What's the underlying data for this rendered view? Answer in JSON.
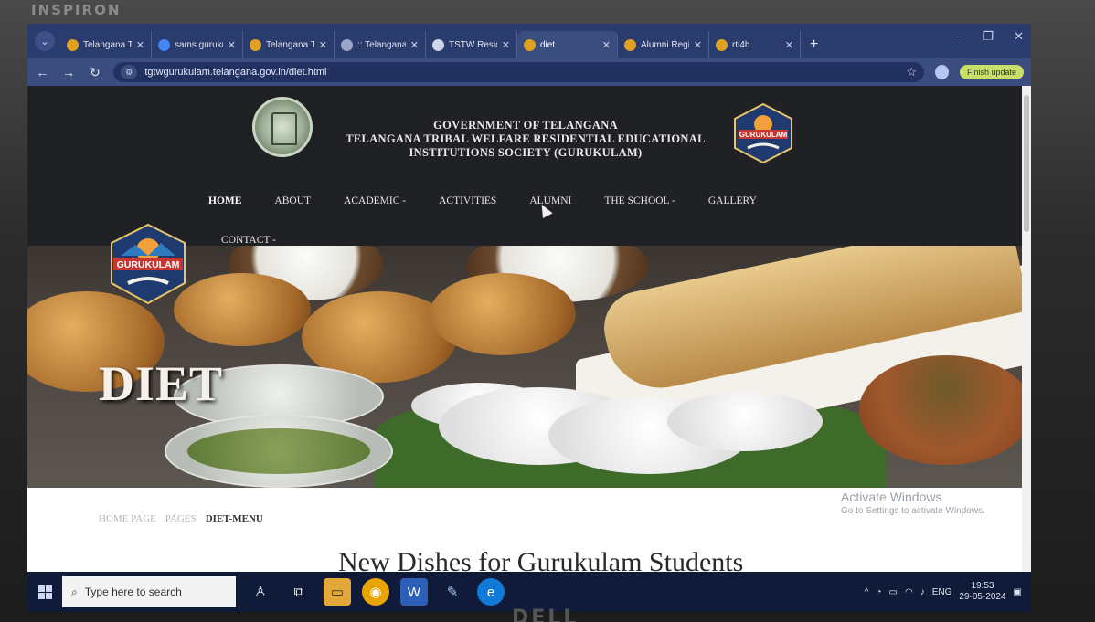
{
  "monitor": {
    "brand_top": "INSPIRON",
    "brand_bottom": "DELL"
  },
  "browser": {
    "tabs": [
      {
        "title": "Telangana Tr",
        "favicon_color": "#e0a020",
        "active": false
      },
      {
        "title": "sams gurukul",
        "favicon_color": "#4285f4",
        "active": false
      },
      {
        "title": "Telangana Tr",
        "favicon_color": "#e0a020",
        "active": false
      },
      {
        "title": ":: Telangana",
        "favicon_color": "#9aa7c9",
        "active": false
      },
      {
        "title": "TSTW Reside",
        "favicon_color": "#cfd6ea",
        "active": false
      },
      {
        "title": "diet",
        "favicon_color": "#e0a020",
        "active": true
      },
      {
        "title": "Alumni Regi",
        "favicon_color": "#e0a020",
        "active": false
      },
      {
        "title": "rti4b",
        "favicon_color": "#e0a020",
        "active": false
      }
    ],
    "url": "tgtwgurukulam.telangana.gov.in/diet.html",
    "update_label": "Finish update"
  },
  "page": {
    "gov_title_line1": "GOVERNMENT OF TELANGANA",
    "gov_title_line2": "TELANGANA TRIBAL WELFARE RESIDENTIAL EDUCATIONAL",
    "gov_title_line3": "INSTITUTIONS SOCIETY (GURUKULAM)",
    "logo_text": "GURUKULAM",
    "nav": [
      {
        "label": "HOME"
      },
      {
        "label": "ABOUT"
      },
      {
        "label": "ACADEMIC -"
      },
      {
        "label": "ACTIVITIES"
      },
      {
        "label": "ALUMNI"
      },
      {
        "label": "THE SCHOOL -"
      },
      {
        "label": "GALLERY"
      }
    ],
    "contact_label": "CONTACT -",
    "banner_title": "DIET",
    "breadcrumb": {
      "home": "HOME PAGE",
      "pages": "PAGES",
      "current": "DIET-MENU"
    },
    "subheading": "New Dishes for Gurukulam Students",
    "activate_title": "Activate Windows",
    "activate_sub": "Go to Settings to activate Windows."
  },
  "taskbar": {
    "search_placeholder": "Type here to search",
    "language": "ENG",
    "time": "19:53",
    "date": "29-05-2024"
  }
}
